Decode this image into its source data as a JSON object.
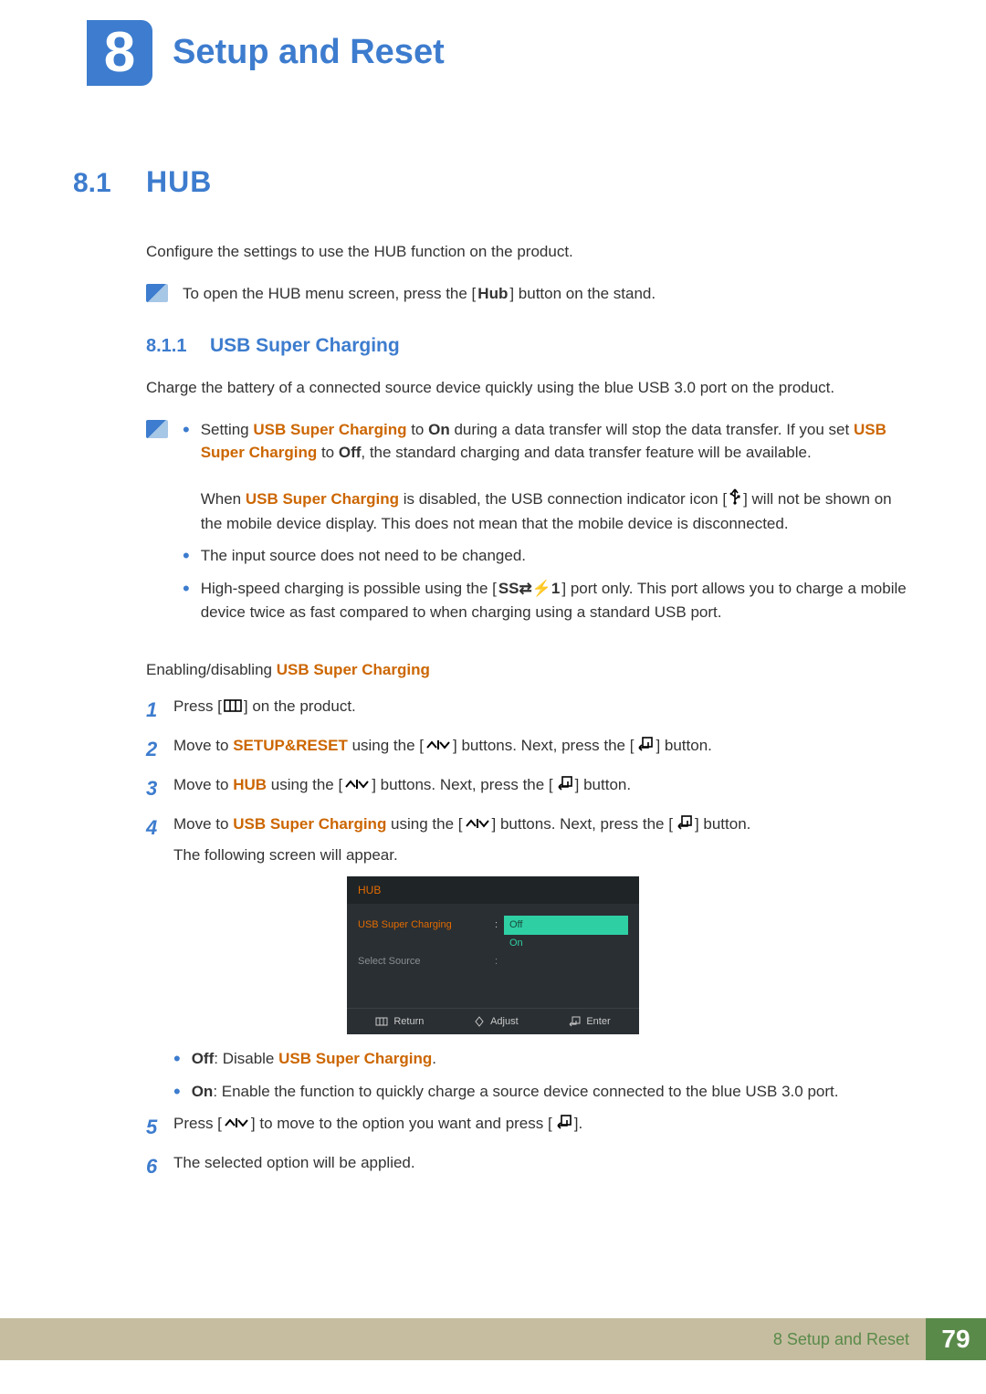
{
  "chapter": {
    "number": "8",
    "title": "Setup and Reset"
  },
  "section": {
    "number": "8.1",
    "title": "HUB"
  },
  "intro": "Configure the settings to use the HUB function on the product.",
  "open_note_a": "To open the HUB menu screen, press the [",
  "open_note_b": "] button on the stand.",
  "hub_glyph": "Hub",
  "subsection": {
    "number": "8.1.1",
    "title": "USB Super Charging"
  },
  "sub_intro": "Charge the battery of a connected source device quickly using the blue USB 3.0 port on the product.",
  "note_bullets": {
    "b1a": "Setting ",
    "b1b": "USB Super Charging",
    "b1c": " to ",
    "b1d": "On",
    "b1e": " during a data transfer will stop the data transfer. If you set ",
    "b1f": "USB Super Charging",
    "b1g": " to ",
    "b1h": "Off",
    "b1i": ", the standard charging and data transfer feature will be available.",
    "b1j": "When ",
    "b1k": "USB Super Charging",
    "b1l": " is disabled, the USB connection indicator icon [",
    "b1m": "] will not be shown on the mobile device display. This does not mean that the mobile device is disconnected.",
    "b2": "The input source does not need to be changed.",
    "b3a": "High-speed charging is possible using the [",
    "b3b": "] port only. This port allows you to charge a mobile device twice as fast compared to when charging using a standard USB port.",
    "ss_glyph": "SS⇄⚡1"
  },
  "enable_title_a": "Enabling/disabling ",
  "enable_title_b": "USB Super Charging",
  "steps": {
    "s1a": "Press [",
    "s1b": "] on the product.",
    "s2a": "Move to ",
    "s2b": "SETUP&RESET",
    "s2c": " using the [",
    "s2d": "] buttons. Next, press the [",
    "s2e": "] button.",
    "s3a": "Move to ",
    "s3b": "HUB",
    "s3c": " using the [",
    "s3d": "] buttons. Next, press the [",
    "s3e": "] button.",
    "s4a": "Move to ",
    "s4b": "USB Super Charging",
    "s4c": " using the [",
    "s4d": "] buttons. Next, press the [",
    "s4e": "] button.",
    "s4f": "The following screen will appear.",
    "s5a": "Press [",
    "s5b": "] to move to the option you want and press [",
    "s5c": "].",
    "s6": "The selected option will be applied.",
    "n1": "1",
    "n2": "2",
    "n3": "3",
    "n4": "4",
    "n5": "5",
    "n6": "6"
  },
  "osd": {
    "title": "HUB",
    "row1": "USB Super Charging",
    "row2": "Select Source",
    "off": "Off",
    "on": "On",
    "return": "Return",
    "adjust": "Adjust",
    "enter": "Enter"
  },
  "opt_bullets": {
    "off_a": "Off",
    "off_b": ": Disable ",
    "off_c": "USB Super Charging",
    "off_d": ".",
    "on_a": "On",
    "on_b": ": Enable the function to quickly charge a source device connected to the blue USB 3.0 port."
  },
  "footer": {
    "label": "8 Setup and Reset",
    "page": "79"
  }
}
